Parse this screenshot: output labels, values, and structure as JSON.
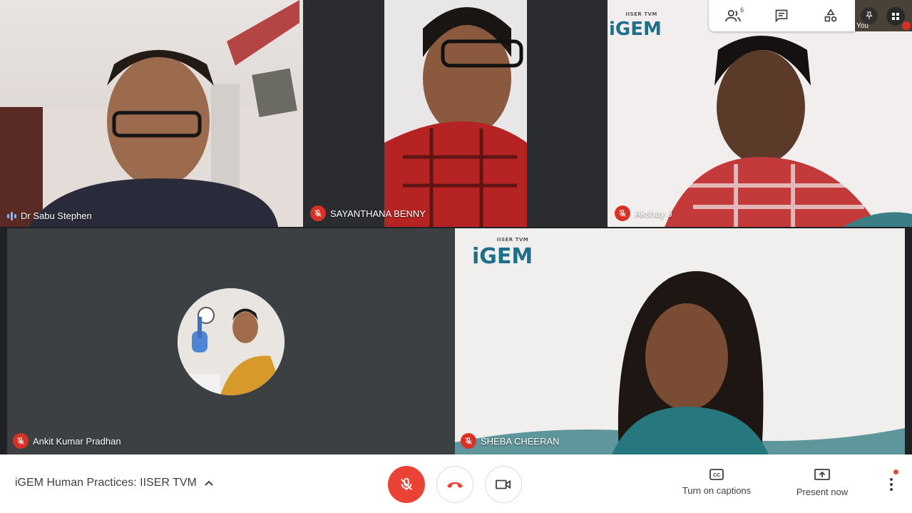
{
  "participants": [
    {
      "name": "Dr Sabu Stephen",
      "state": "speaking"
    },
    {
      "name": "SAYANTHANA BENNY",
      "state": "muted"
    },
    {
      "name": "Akshay J",
      "state": "muted"
    },
    {
      "name": "Ankit Kumar Pradhan",
      "state": "muted"
    },
    {
      "name": "SHEBA CHEERAN",
      "state": "muted"
    }
  ],
  "logo": {
    "text": "iGEM",
    "subtitle": "IISER TVM"
  },
  "toolbar_top": {
    "people_count": "6",
    "self_label": "You"
  },
  "meeting": {
    "title": "iGEM Human Practices: IISER TVM"
  },
  "actions": {
    "captions_label": "Turn on captions",
    "present_label": "Present now"
  },
  "colors": {
    "accent_red": "#ea4335",
    "mute_red": "#d93025",
    "speaking_blue": "#8ab4f8",
    "background": "#202124"
  },
  "icons": [
    "mic-off-icon",
    "end-call-icon",
    "camera-icon",
    "captions-icon",
    "present-icon",
    "more-vert-icon",
    "people-icon",
    "chat-icon",
    "activities-icon",
    "pin-icon",
    "grid-icon",
    "chevron-up-icon"
  ]
}
